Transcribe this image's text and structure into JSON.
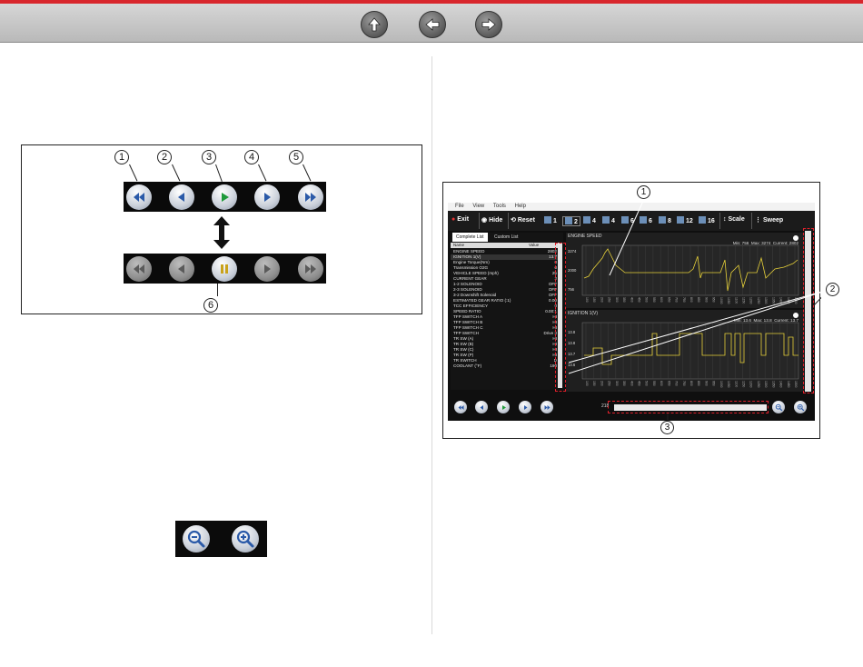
{
  "header": {
    "buttons": [
      {
        "name": "home-up-button",
        "icon": "up-arrow-icon"
      },
      {
        "name": "back-button",
        "icon": "left-arrow-icon"
      },
      {
        "name": "forward-button",
        "icon": "right-arrow-icon"
      }
    ],
    "accent_color": "#d8262c"
  },
  "figure_playback": {
    "callouts": [
      "1",
      "2",
      "3",
      "4",
      "5",
      "6"
    ],
    "top_row": [
      "rewind-icon",
      "step-back-icon",
      "play-icon",
      "step-forward-icon",
      "fast-forward-icon"
    ],
    "bottom_row": [
      "rewind-icon",
      "step-back-icon",
      "pause-icon",
      "step-forward-icon",
      "fast-forward-icon"
    ]
  },
  "figure_zoom": {
    "buttons": [
      "zoom-out-icon",
      "zoom-in-icon"
    ]
  },
  "figure_app": {
    "menu": [
      "File",
      "View",
      "Tools",
      "Help"
    ],
    "toolbar": {
      "exit": "Exit",
      "hide": "Hide",
      "reset": "Reset",
      "layouts": [
        "1",
        "2",
        "4",
        "4",
        "6",
        "6",
        "8",
        "12",
        "16"
      ],
      "scale": "Scale",
      "sweep": "Sweep"
    },
    "tabs": [
      "Complete List",
      "Custom List"
    ],
    "list_headers": {
      "name": "Name",
      "value": "Value"
    },
    "list_rows": [
      {
        "name": "ENGINE SPEED",
        "value": "2802"
      },
      {
        "name": "IGNITION 1(V)",
        "value": "13.7"
      },
      {
        "name": "Engine Torque(Nm)",
        "value": "0"
      },
      {
        "name": "Transmission O2G",
        "value": "0"
      },
      {
        "name": "VEHICLE SPEED (mph)",
        "value": "25"
      },
      {
        "name": "CURRENT GEAR",
        "value": "2"
      },
      {
        "name": "1-2 SOLENOID",
        "value": "OFF"
      },
      {
        "name": "2-3 SOLENOID",
        "value": "OFF"
      },
      {
        "name": "3-2 Downshift Solenoid",
        "value": "OFF"
      },
      {
        "name": "ESTIMATED GEAR RATIO (:1)",
        "value": "0.00"
      },
      {
        "name": "TCC EFFICIENCY",
        "value": "0"
      },
      {
        "name": "SPEED RATIO",
        "value": "0.00:1"
      },
      {
        "name": "TFP SWITCH A",
        "value": "HI"
      },
      {
        "name": "TFP SWITCH B",
        "value": "HI"
      },
      {
        "name": "TFP SWITCH C",
        "value": "HI"
      },
      {
        "name": "TFP SWITCH",
        "value": "Drive 3"
      },
      {
        "name": "TR SW (A)",
        "value": "HI"
      },
      {
        "name": "TR SW (B)",
        "value": "HI"
      },
      {
        "name": "TR SW (C)",
        "value": "HI"
      },
      {
        "name": "TR SW (P)",
        "value": "HI"
      },
      {
        "name": "TR SWITCH",
        "value": "D"
      },
      {
        "name": "COOLANT (°F)",
        "value": "190"
      }
    ],
    "graph1": {
      "title": "ENGINE SPEED",
      "min": "Min: 756",
      "max": "Max: 3274",
      "current": "Current: 2802",
      "y_ticks": [
        "3274",
        "2000",
        "756"
      ],
      "x_ticks": [
        "100",
        "150",
        "200",
        "250",
        "300",
        "350",
        "400",
        "450",
        "500",
        "550",
        "600",
        "650",
        "700",
        "750",
        "800",
        "850",
        "900",
        "950",
        "1000",
        "1050",
        "1100",
        "1150",
        "1200",
        "1250",
        "1300",
        "1350",
        "1400",
        "1450",
        "1500"
      ],
      "color": "#e8d23a"
    },
    "graph2": {
      "title": "IGNITION 1(V)",
      "min": "Min: 13.6",
      "max": "Max: 13.8",
      "current": "Current: 13.7",
      "y_ticks": [
        "13.8",
        "13.8",
        "13.7",
        "13.6"
      ],
      "x_ticks": [
        "100",
        "150",
        "200",
        "250",
        "300",
        "350",
        "400",
        "450",
        "500",
        "550",
        "600",
        "650",
        "700",
        "750",
        "800",
        "850",
        "900",
        "950",
        "1000",
        "1050",
        "1100",
        "1150",
        "1200",
        "1250",
        "1300",
        "1350",
        "1400",
        "1450",
        "1500"
      ],
      "color": "#e8d23a"
    },
    "counter": "218",
    "callouts": [
      "1",
      "2",
      "3"
    ],
    "highlight_color": "#e0202b"
  }
}
